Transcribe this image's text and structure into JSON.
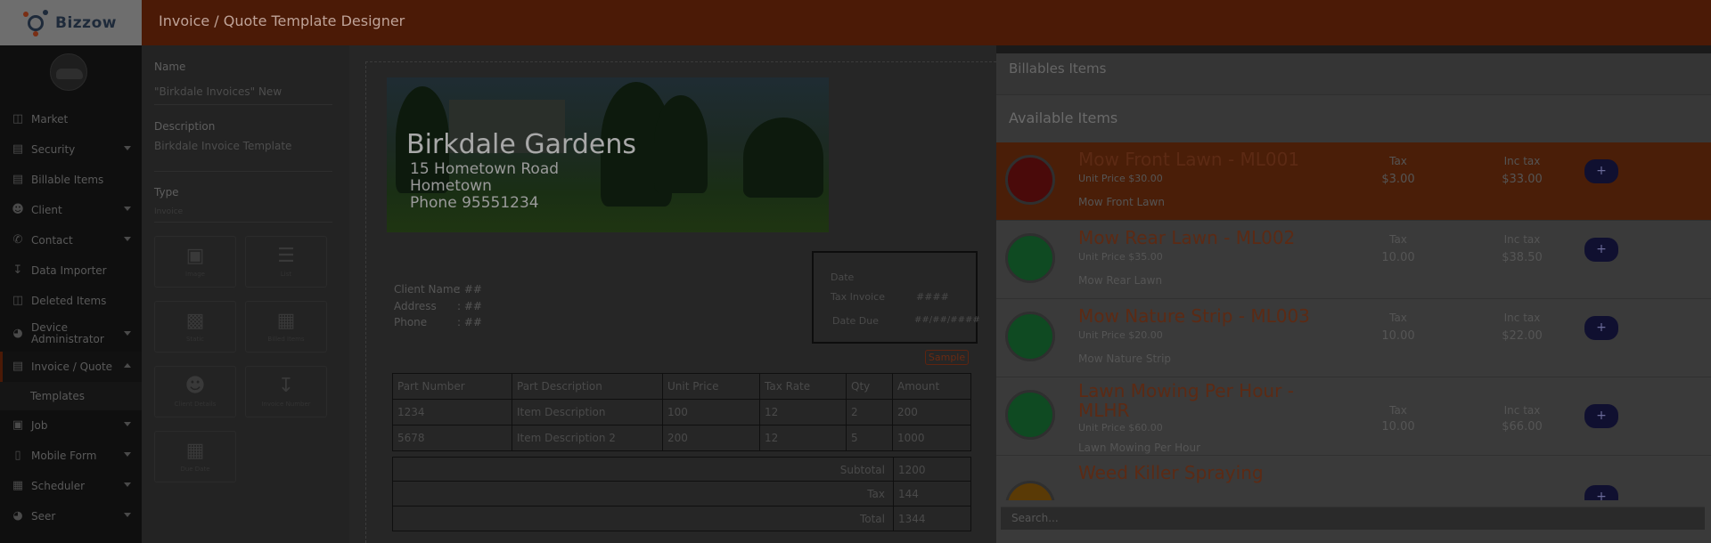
{
  "app": {
    "logo_text": "Bizzow",
    "page_title": "Invoice / Quote Template Designer"
  },
  "sidebar": {
    "items": [
      {
        "label": "Market",
        "icon": "shopping-bag-icon"
      },
      {
        "label": "Security",
        "icon": "lock-icon"
      },
      {
        "label": "Billable Items",
        "icon": "receipt-icon"
      },
      {
        "label": "Client",
        "icon": "users-icon"
      },
      {
        "label": "Contact",
        "icon": "phone-icon"
      },
      {
        "label": "Data Importer",
        "icon": "import-icon"
      },
      {
        "label": "Deleted Items",
        "icon": "trash-icon"
      },
      {
        "label": "Device Administrator",
        "icon": "globe-icon"
      },
      {
        "label": "Invoice / Quote",
        "icon": "invoice-icon"
      },
      {
        "label": "Job",
        "icon": "briefcase-icon"
      },
      {
        "label": "Mobile Form",
        "icon": "mobile-icon"
      },
      {
        "label": "Scheduler",
        "icon": "calendar-icon"
      },
      {
        "label": "Seer",
        "icon": "globe-icon"
      }
    ],
    "sub_item": "Templates"
  },
  "properties": {
    "name_label": "Name",
    "name_value": "\"Birkdale Invoices\" New",
    "description_label": "Description",
    "description_value": "Birkdale Invoice Template",
    "type_label": "Type",
    "type_value": "Invoice",
    "tools": [
      {
        "label": "Image",
        "icon": "image-icon"
      },
      {
        "label": "List",
        "icon": "list-icon"
      },
      {
        "label": "Static",
        "icon": "cube-icon"
      },
      {
        "label": "Billed Items",
        "icon": "grid-icon"
      },
      {
        "label": "Client Details",
        "icon": "person-icon"
      },
      {
        "label": "Invoice Number",
        "icon": "sort-numeric-icon"
      },
      {
        "label": "Due Date",
        "icon": "calendar-icon"
      }
    ]
  },
  "template": {
    "banner": {
      "title": "Birkdale Gardens",
      "address": "15 Hometown Road",
      "city": "Hometown",
      "phone": "Phone 95551234"
    },
    "client": {
      "name_label": "Client Name",
      "name_value": ": ##",
      "address_label": "Address",
      "address_value": ": ##",
      "phone_label": "Phone",
      "phone_value": ": ##"
    },
    "date_box": {
      "date_label": "Date",
      "tax_invoice_label": "Tax Invoice",
      "tax_invoice_value": "####",
      "due_label": "Date Due",
      "due_value": "##/##/####"
    },
    "sample_label": "Sample",
    "table": {
      "headers": [
        "Part Number",
        "Part Description",
        "Unit Price",
        "Tax Rate",
        "Qty",
        "Amount"
      ],
      "rows": [
        [
          "1234",
          "Item Description",
          "100",
          "12",
          "2",
          "200"
        ],
        [
          "5678",
          "Item Description 2",
          "200",
          "12",
          "5",
          "1000"
        ]
      ]
    },
    "totals": {
      "subtotal_label": "Subtotal",
      "subtotal_value": "1200",
      "tax_label": "Tax",
      "tax_value": "144",
      "total_label": "Total",
      "total_value": "1344"
    }
  },
  "billables": {
    "header": "Billables Items",
    "subheader": "Available Items",
    "items": [
      {
        "name": "Mow Front Lawn - ML001",
        "unit_price": "Unit Price $30.00",
        "desc": "Mow Front Lawn",
        "tax_label": "Tax",
        "tax": "$3.00",
        "inc_label": "Inc tax",
        "inc": "$33.00",
        "color": "#4a0a0a"
      },
      {
        "name": "Mow Rear Lawn - ML002",
        "unit_price": "Unit Price $35.00",
        "desc": "Mow Rear Lawn",
        "tax_label": "Tax",
        "tax": "10.00",
        "inc_label": "Inc tax",
        "inc": "$38.50",
        "color": "#0f4a22"
      },
      {
        "name": "Mow Nature Strip - ML003",
        "unit_price": "Unit Price $20.00",
        "desc": "Mow Nature Strip",
        "tax_label": "Tax",
        "tax": "10.00",
        "inc_label": "Inc tax",
        "inc": "$22.00",
        "color": "#0f4a22"
      },
      {
        "name": "Lawn Mowing Per Hour - MLHR",
        "unit_price": "Unit Price $60.00",
        "desc": "Lawn Mowing Per Hour",
        "tax_label": "Tax",
        "tax": "10.00",
        "inc_label": "Inc tax",
        "inc": "$66.00",
        "color": "#0f4a22"
      },
      {
        "name": "Weed Killer Spraying",
        "unit_price": "",
        "desc": "",
        "tax_label": "",
        "tax": "",
        "inc_label": "",
        "inc": "",
        "color": "#5a3a06"
      }
    ],
    "add_label": "+",
    "search_placeholder": "Search..."
  }
}
